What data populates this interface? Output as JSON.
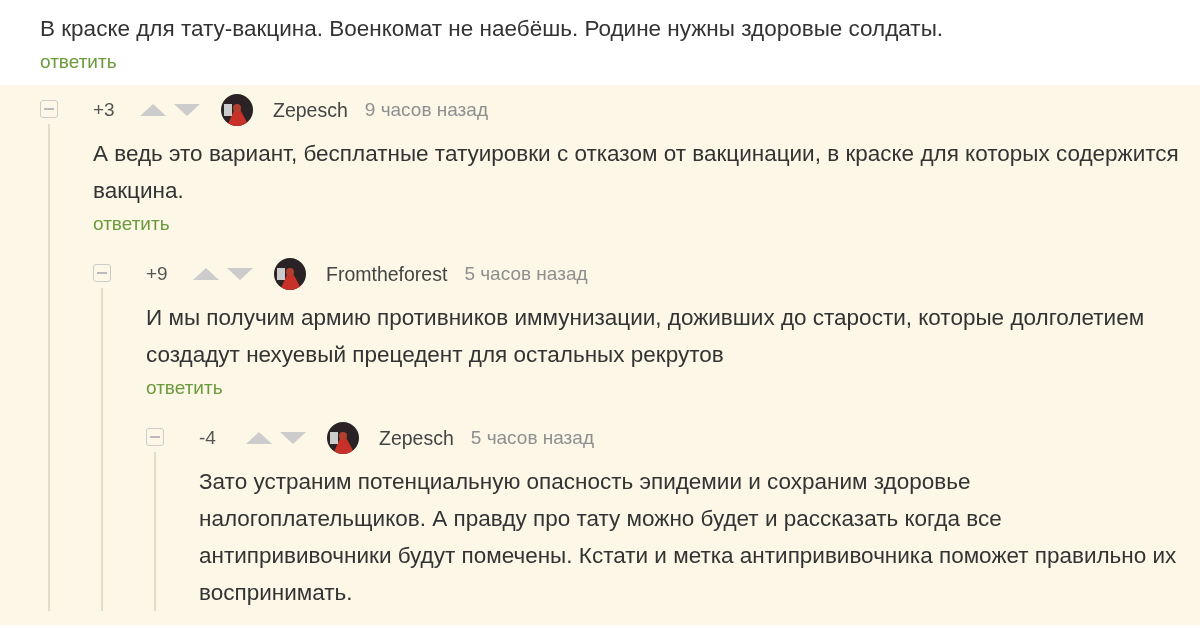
{
  "parent_comment": {
    "text": "В краске для тату-вакцина. Военкомат не наебёшь. Родине нужны здоровые солдаты.",
    "reply": "ответить"
  },
  "comments": [
    {
      "score": "+3",
      "author": "Zepesch",
      "time": "9 часов назад",
      "text": "А ведь это вариант, бесплатные татуировки с отказом от вакцинации, в краске для которых содержится вакцина.",
      "reply": "ответить",
      "children": [
        {
          "score": "+9",
          "author": "Fromtheforest",
          "time": "5 часов назад",
          "text": "И мы получим армию противников иммунизации, доживших до старости, которые долголетием создадут нехуевый прецедент для остальных рекрутов",
          "reply": "ответить",
          "children": [
            {
              "score": "-4",
              "author": "Zepesch",
              "time": "5 часов назад",
              "text": "Зато устраним потенциальную опасность эпидемии и сохраним здоровье налогоплательщиков. А правду про тату можно будет и рассказать когда все антипрививочники будут помечены. Кстати и метка антипрививочника поможет правильно их воспринимать."
            }
          ]
        }
      ]
    }
  ]
}
